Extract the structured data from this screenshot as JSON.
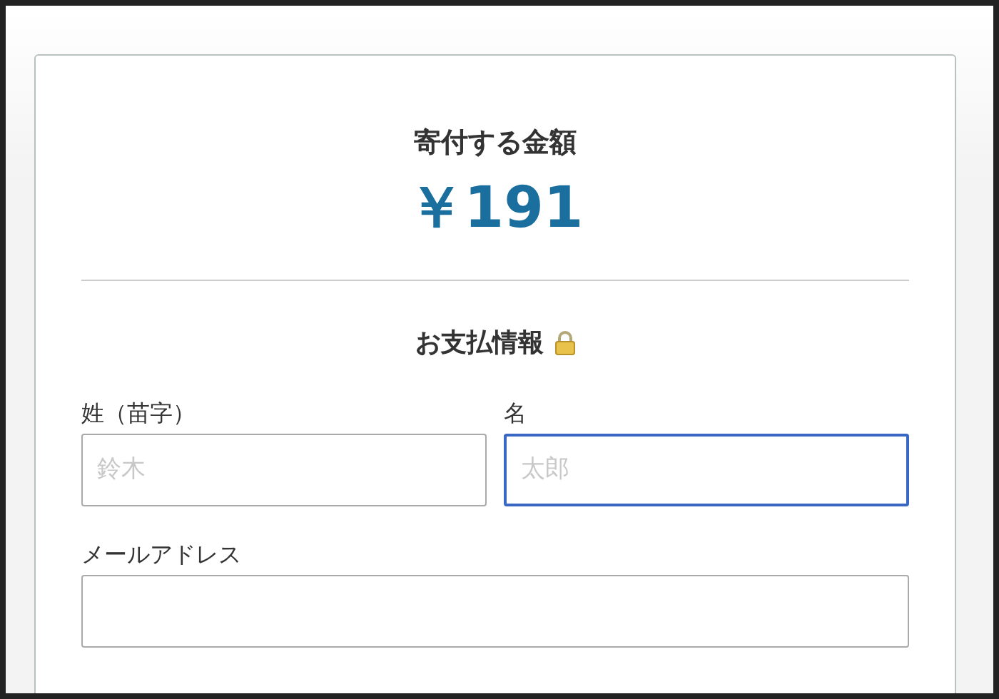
{
  "donation": {
    "title": "寄付する金額",
    "amount": "￥191"
  },
  "payment": {
    "title": "お支払情報"
  },
  "fields": [
    {
      "label": "姓（苗字）",
      "placeholder": "鈴木",
      "focused": false,
      "kind": "half"
    },
    {
      "label": "名",
      "placeholder": "太郎",
      "focused": true,
      "kind": "half"
    },
    {
      "label": "メールアドレス",
      "focused": false,
      "kind": "full"
    }
  ]
}
